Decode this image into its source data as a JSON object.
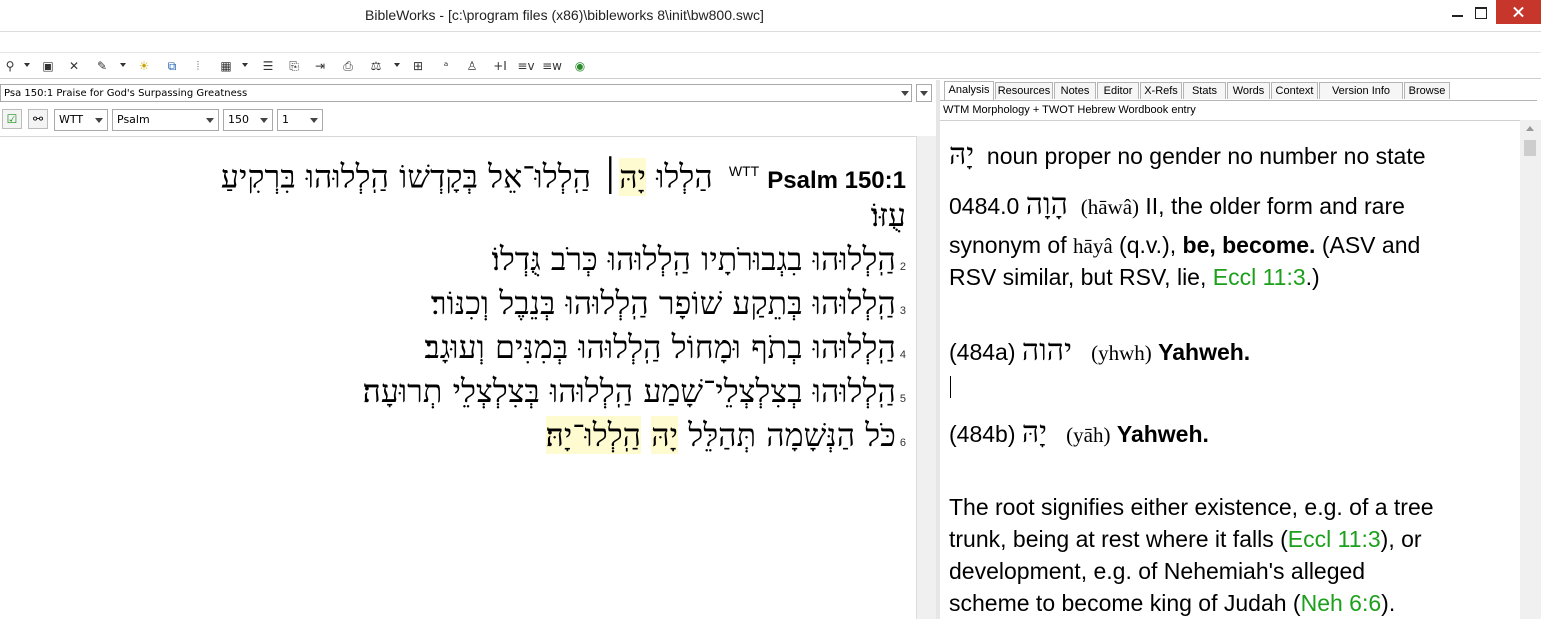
{
  "window": {
    "title": "BibleWorks - [c:\\program files (x86)\\bibleworks 8\\init\\bw800.swc]",
    "minimize": "—",
    "close": "×"
  },
  "toolbar": {
    "icons": [
      "bible-search-icon",
      "open-folder-icon",
      "cross-ref-icon",
      "highlight-icon",
      "tools-icon",
      "window-icon",
      "columns-icon",
      "grid-icon",
      "list-icon",
      "copy-icon",
      "export-icon",
      "print-icon",
      "lexicon-icon",
      "split-icon",
      "notes-icon",
      "editor-icon",
      "add-verse-icon",
      "verse-v-icon",
      "verse-w-icon",
      "globe-icon"
    ],
    "verse_labels": [
      "+I",
      "≡v",
      "≡w"
    ]
  },
  "verse_combo": {
    "value": "Psa 150:1 Praise for God's Surpassing Greatness"
  },
  "nav": {
    "version": "WTT",
    "book": "Psalm",
    "chapter": "150",
    "verse": "1"
  },
  "bible_text": {
    "version_label": "WTT",
    "reference": "Psalm 150:1",
    "verses": [
      {
        "num": "",
        "pre": "הַלְלוּ",
        "hl": "יָהּ",
        "post": "׀ הַֽלְלוּ־אֵל בְּקָדְשׁוֹ הַֽלְלוּהוּ בִּרְקִיעַ"
      },
      {
        "num": "",
        "pre": "",
        "hl": "",
        "post": "עֻזּוֹ׃"
      },
      {
        "num": "2",
        "pre": "",
        "hl": "",
        "post": "הַֽלְלוּהוּ בִגְבוּרֹתָיו הַֽלְלוּהוּ כְּרֹב גֻּדְלוֹ׃"
      },
      {
        "num": "3",
        "pre": "",
        "hl": "",
        "post": "הַֽלְלוּהוּ בְּתֵקַע שׁוֹפָר הַֽלְלוּהוּ בְּנֵבֶל וְכִנּוֹר׃"
      },
      {
        "num": "4",
        "pre": "",
        "hl": "",
        "post": "הַֽלְלוּהוּ בְתֹף וּמָחוֹל הַֽלְלוּהוּ בְּמִנִּים וְעוּגָב׃"
      },
      {
        "num": "5",
        "pre": "",
        "hl": "",
        "post": "הַֽלְלוּהוּ בְצִלְצְלֵי־שָׁמַע הַֽלְלוּהוּ בְּצִלְצְלֵי תְרוּעָה׃"
      },
      {
        "num": "6",
        "pre": "כֹּל הַנְּשָׁמָה תְּהַלֵּל",
        "hl": "יָהּ",
        "post": "הַֽלְלוּ־יָהּ׃"
      }
    ]
  },
  "tabs": [
    "Analysis",
    "Resources",
    "Notes",
    "Editor",
    "X-Refs",
    "Stats",
    "Words",
    "Context",
    "Version Info",
    "Browse"
  ],
  "entry_header": "WTM Morphology + TWOT Hebrew Wordbook entry",
  "analysis": {
    "word": "יָהּ",
    "parse": "noun proper no gender no number no state",
    "entry_num": "0484.0",
    "entry_heb": "הָוָה",
    "entry_translit": "(hāwâ)",
    "entry_def1": "II, the older form and rare",
    "syn_prefix": "synonym of",
    "syn_translit": "hāyâ",
    "syn_qv": "(q.v.),",
    "syn_bold": "be, become.",
    "syn_rest": "(ASV and",
    "rsv_text": "RSV similar, but RSV, lie,",
    "rsv_link": "Eccl 11:3",
    "rsv_close": ".)",
    "sub_a_num": "(484a)",
    "sub_a_heb": "יהוה",
    "sub_a_translit": "(yhwh)",
    "sub_a_gloss": "Yahweh.",
    "sub_b_num": "(484b)",
    "sub_b_heb": "יָהּ",
    "sub_b_translit": "(yāh)",
    "sub_b_gloss": "Yahweh.",
    "root_1": "The root signifies either existence, e.g. of a tree",
    "root_2_pre": "trunk, being at rest where it falls (",
    "root_2_link": "Eccl 11:3",
    "root_2_post": "), or",
    "root_3": "development, e.g. of Nehemiah's alleged",
    "root_4_pre": "scheme to become king of Judah (",
    "root_4_link": "Neh 6:6",
    "root_4_post": ")."
  },
  "colors": {
    "highlight": "#fffbd0",
    "link": "#1ca01c",
    "close_button": "#c7362a"
  }
}
